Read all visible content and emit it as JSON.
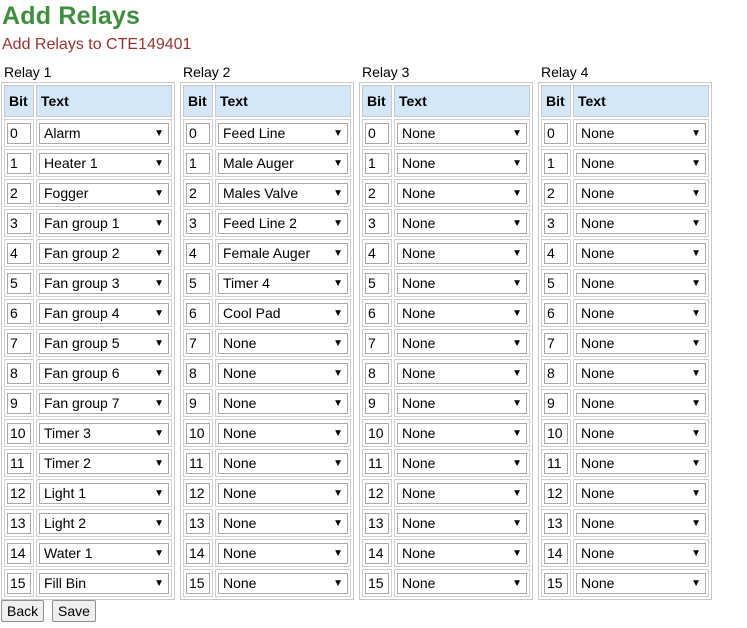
{
  "page": {
    "title": "Add Relays",
    "subtitle": "Add Relays to CTE149401"
  },
  "columns": {
    "bit": "Bit",
    "text": "Text"
  },
  "relays": [
    {
      "label": "Relay 1",
      "rows": [
        {
          "bit": "0",
          "text": "Alarm"
        },
        {
          "bit": "1",
          "text": "Heater 1"
        },
        {
          "bit": "2",
          "text": "Fogger"
        },
        {
          "bit": "3",
          "text": "Fan group 1"
        },
        {
          "bit": "4",
          "text": "Fan group 2"
        },
        {
          "bit": "5",
          "text": "Fan group 3"
        },
        {
          "bit": "6",
          "text": "Fan group 4"
        },
        {
          "bit": "7",
          "text": "Fan group 5"
        },
        {
          "bit": "8",
          "text": "Fan group 6"
        },
        {
          "bit": "9",
          "text": "Fan group 7"
        },
        {
          "bit": "10",
          "text": "Timer 3"
        },
        {
          "bit": "11",
          "text": "Timer 2"
        },
        {
          "bit": "12",
          "text": "Light 1"
        },
        {
          "bit": "13",
          "text": "Light 2"
        },
        {
          "bit": "14",
          "text": "Water 1"
        },
        {
          "bit": "15",
          "text": "Fill Bin"
        }
      ]
    },
    {
      "label": "Relay 2",
      "rows": [
        {
          "bit": "0",
          "text": "Feed Line"
        },
        {
          "bit": "1",
          "text": "Male Auger"
        },
        {
          "bit": "2",
          "text": "Males Valve"
        },
        {
          "bit": "3",
          "text": "Feed Line 2"
        },
        {
          "bit": "4",
          "text": "Female Auger"
        },
        {
          "bit": "5",
          "text": "Timer 4"
        },
        {
          "bit": "6",
          "text": "Cool Pad"
        },
        {
          "bit": "7",
          "text": "None"
        },
        {
          "bit": "8",
          "text": "None"
        },
        {
          "bit": "9",
          "text": "None"
        },
        {
          "bit": "10",
          "text": "None"
        },
        {
          "bit": "11",
          "text": "None"
        },
        {
          "bit": "12",
          "text": "None"
        },
        {
          "bit": "13",
          "text": "None"
        },
        {
          "bit": "14",
          "text": "None"
        },
        {
          "bit": "15",
          "text": "None"
        }
      ]
    },
    {
      "label": "Relay 3",
      "rows": [
        {
          "bit": "0",
          "text": "None"
        },
        {
          "bit": "1",
          "text": "None"
        },
        {
          "bit": "2",
          "text": "None"
        },
        {
          "bit": "3",
          "text": "None"
        },
        {
          "bit": "4",
          "text": "None"
        },
        {
          "bit": "5",
          "text": "None"
        },
        {
          "bit": "6",
          "text": "None"
        },
        {
          "bit": "7",
          "text": "None"
        },
        {
          "bit": "8",
          "text": "None"
        },
        {
          "bit": "9",
          "text": "None"
        },
        {
          "bit": "10",
          "text": "None"
        },
        {
          "bit": "11",
          "text": "None"
        },
        {
          "bit": "12",
          "text": "None"
        },
        {
          "bit": "13",
          "text": "None"
        },
        {
          "bit": "14",
          "text": "None"
        },
        {
          "bit": "15",
          "text": "None"
        }
      ]
    },
    {
      "label": "Relay 4",
      "rows": [
        {
          "bit": "0",
          "text": "None"
        },
        {
          "bit": "1",
          "text": "None"
        },
        {
          "bit": "2",
          "text": "None"
        },
        {
          "bit": "3",
          "text": "None"
        },
        {
          "bit": "4",
          "text": "None"
        },
        {
          "bit": "5",
          "text": "None"
        },
        {
          "bit": "6",
          "text": "None"
        },
        {
          "bit": "7",
          "text": "None"
        },
        {
          "bit": "8",
          "text": "None"
        },
        {
          "bit": "9",
          "text": "None"
        },
        {
          "bit": "10",
          "text": "None"
        },
        {
          "bit": "11",
          "text": "None"
        },
        {
          "bit": "12",
          "text": "None"
        },
        {
          "bit": "13",
          "text": "None"
        },
        {
          "bit": "14",
          "text": "None"
        },
        {
          "bit": "15",
          "text": "None"
        }
      ]
    }
  ],
  "buttons": {
    "back": "Back",
    "save": "Save"
  }
}
